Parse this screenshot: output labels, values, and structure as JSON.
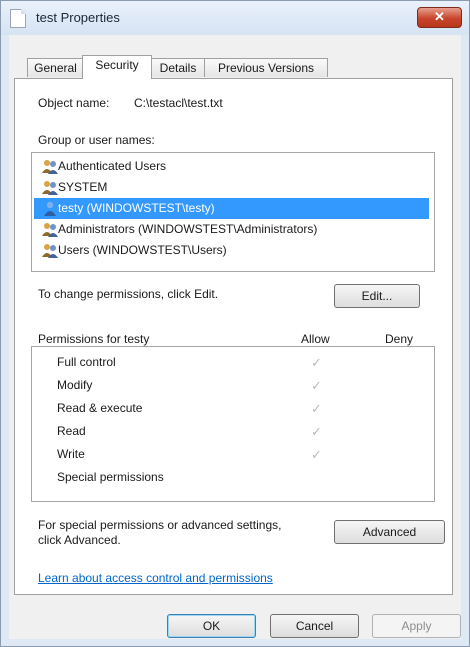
{
  "window": {
    "title": "test Properties",
    "close_label": "✕"
  },
  "tabs": [
    {
      "label": "General",
      "active": false
    },
    {
      "label": "Security",
      "active": true
    },
    {
      "label": "Details",
      "active": false
    },
    {
      "label": "Previous Versions",
      "active": false
    }
  ],
  "security": {
    "object_name_label": "Object name:",
    "object_name_value": "C:\\testacl\\test.txt",
    "group_label": "Group or user names:",
    "users": [
      {
        "name": "Authenticated Users",
        "icon": "group-users-icon",
        "selected": false
      },
      {
        "name": "SYSTEM",
        "icon": "group-users-icon",
        "selected": false
      },
      {
        "name": "testy (WINDOWSTEST\\testy)",
        "icon": "single-user-icon",
        "selected": true
      },
      {
        "name": "Administrators (WINDOWSTEST\\Administrators)",
        "icon": "group-users-icon",
        "selected": false
      },
      {
        "name": "Users (WINDOWSTEST\\Users)",
        "icon": "group-users-icon",
        "selected": false
      }
    ],
    "change_hint": "To change permissions, click Edit.",
    "edit_label": "Edit...",
    "permissions_header": "Permissions for testy",
    "allow_header": "Allow",
    "deny_header": "Deny",
    "permissions": [
      {
        "name": "Full control",
        "allow": true,
        "deny": false
      },
      {
        "name": "Modify",
        "allow": true,
        "deny": false
      },
      {
        "name": "Read & execute",
        "allow": true,
        "deny": false
      },
      {
        "name": "Read",
        "allow": true,
        "deny": false
      },
      {
        "name": "Write",
        "allow": true,
        "deny": false
      },
      {
        "name": "Special permissions",
        "allow": false,
        "deny": false
      }
    ],
    "advanced_hint_line1": "For special permissions or advanced settings,",
    "advanced_hint_line2": "click Advanced.",
    "advanced_label": "Advanced",
    "help_link": "Learn about access control and permissions"
  },
  "footer": {
    "ok_label": "OK",
    "cancel_label": "Cancel",
    "apply_label": "Apply"
  },
  "colors": {
    "selection": "#3399ff",
    "link": "#0066cc",
    "close_button": "#c7462b"
  }
}
